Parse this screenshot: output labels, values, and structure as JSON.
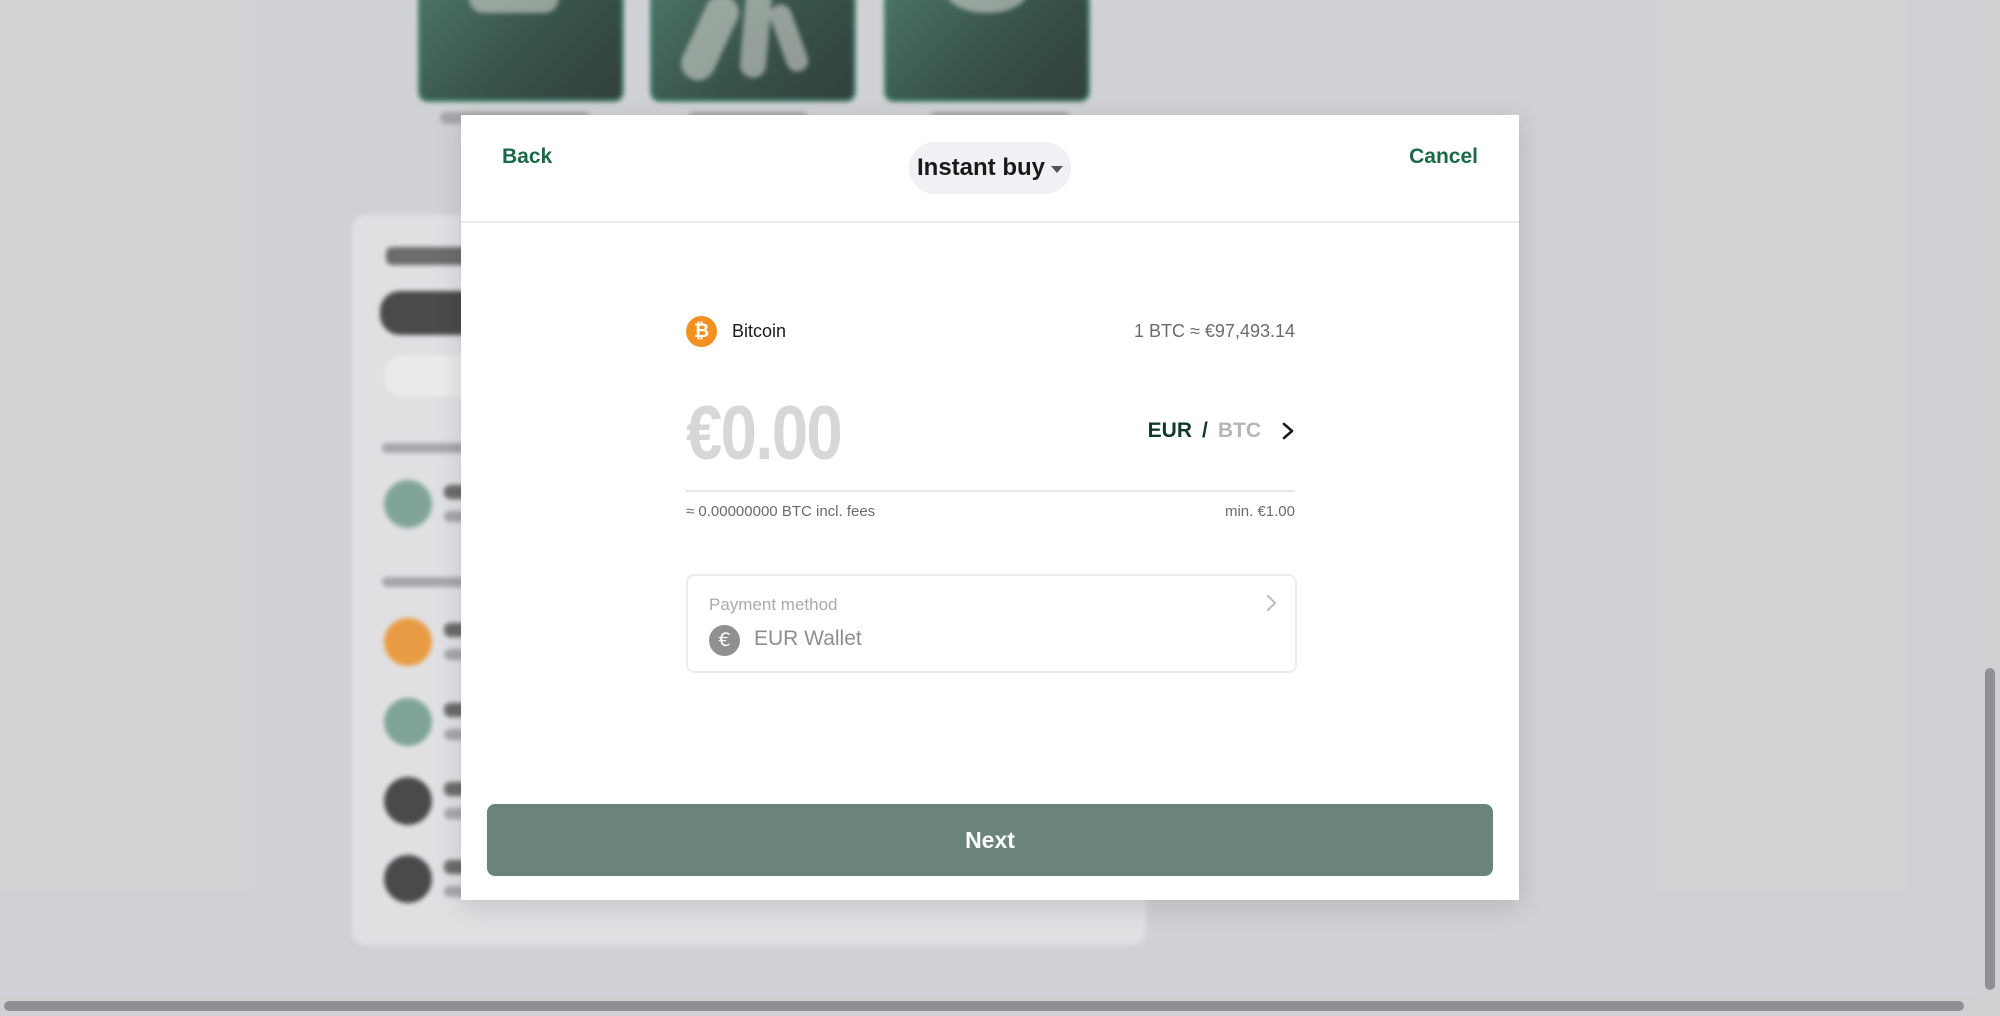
{
  "modal": {
    "back_label": "Back",
    "cancel_label": "Cancel",
    "mode_label": "Instant buy",
    "asset": {
      "name": "Bitcoin",
      "rate": "1 BTC ≈ €97,493.14",
      "icon": "bitcoin-icon",
      "color": "#f29121"
    },
    "amount": "€0.00",
    "currency_primary": "EUR",
    "currency_separator": "/",
    "currency_secondary": "BTC",
    "conversion_note": "≈ 0.00000000 BTC incl. fees",
    "minimum_note": "min. €1.00",
    "payment": {
      "label": "Payment method",
      "method": "EUR Wallet",
      "icon": "euro-icon"
    },
    "next_label": "Next"
  },
  "colors": {
    "accent": "#1b6a47",
    "next_button": "#6a847c",
    "bitcoin": "#f29121"
  }
}
